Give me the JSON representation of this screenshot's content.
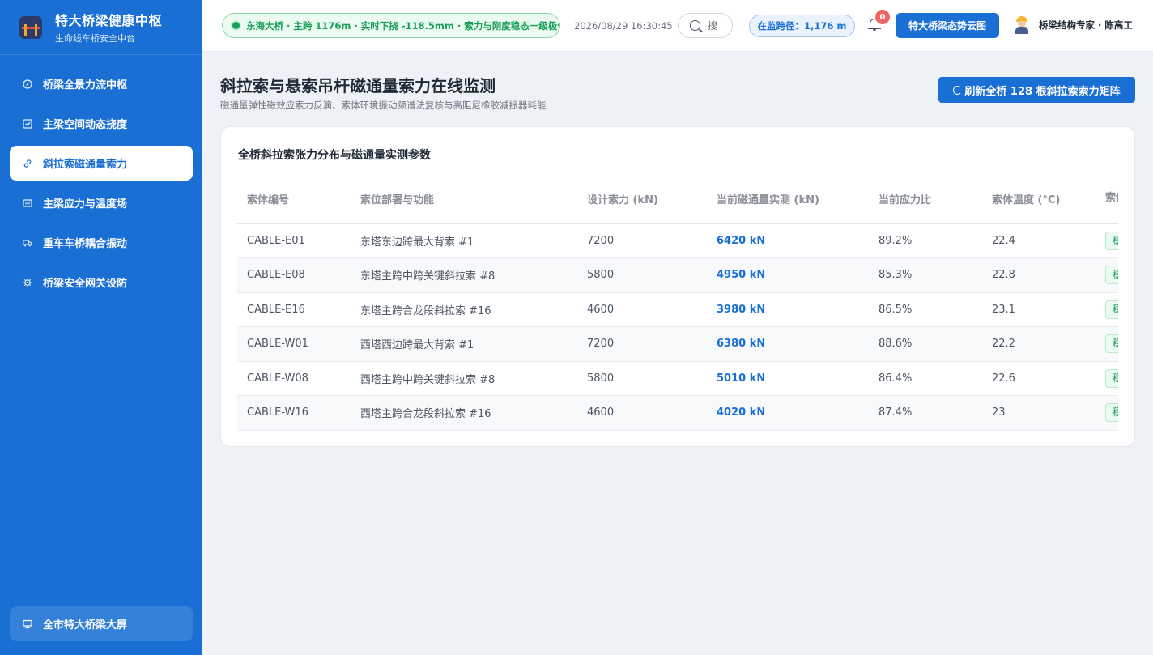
{
  "brand": {
    "title": "特大桥梁健康中枢",
    "subtitle": "生命线车桥安全中台"
  },
  "sidebar": {
    "items": [
      {
        "label": "桥梁全景力流中枢",
        "icon": "compass-icon"
      },
      {
        "label": "主梁空间动态挠度",
        "icon": "line-chart-icon"
      },
      {
        "label": "斜拉索磁通量索力",
        "icon": "link-icon",
        "active": true
      },
      {
        "label": "主梁应力与温度场",
        "icon": "sensor-icon"
      },
      {
        "label": "重车车桥耦合振动",
        "icon": "truck-icon"
      },
      {
        "label": "桥梁安全网关设防",
        "icon": "gear-icon"
      }
    ],
    "footer_label": "全市特大桥梁大屏",
    "footer_icon": "monitor-icon"
  },
  "header": {
    "status_text": "东海大桥 · 主跨 1176m · 实时下挠 -118.5mm · 索力与刚度稳态一级极优",
    "datetime": "2026/08/29 16:30:45",
    "search_placeholder": "搜",
    "span_text": "在监跨径：1,176 m",
    "notification_count": "0",
    "primary_button": "特大桥梁态势云图",
    "user_name": "桥梁结构专家 · 陈高工"
  },
  "page": {
    "title": "斜拉索与悬索吊杆磁通量索力在线监测",
    "subtitle": "磁通量弹性磁效应索力反演、索体环境振动频谱法复核与高阻尼橡胶减振器耗能",
    "refresh_button": "刷新全桥 128 根斜拉索索力矩阵"
  },
  "card": {
    "title": "全桥斜拉索张力分布与磁通量实测参数",
    "columns": [
      "索体编号",
      "索位部署与功能",
      "设计索力 (kN)",
      "当前磁通量实测 (kN)",
      "当前应力比",
      "索体温度 (°C)",
      "索体状态"
    ],
    "rows": [
      {
        "id": "CABLE-E01",
        "position": "东塔东边跨最大背索 #1",
        "design": "7200",
        "flux": "6420 kN",
        "ratio": "89.2%",
        "temp": "22.4",
        "status": "稳定"
      },
      {
        "id": "CABLE-E08",
        "position": "东塔主跨中跨关键斜拉索 #8",
        "design": "5800",
        "flux": "4950 kN",
        "ratio": "85.3%",
        "temp": "22.8",
        "status": "稳定"
      },
      {
        "id": "CABLE-E16",
        "position": "东塔主跨合龙段斜拉索 #16",
        "design": "4600",
        "flux": "3980 kN",
        "ratio": "86.5%",
        "temp": "23.1",
        "status": "稳定"
      },
      {
        "id": "CABLE-W01",
        "position": "西塔西边跨最大背索 #1",
        "design": "7200",
        "flux": "6380 kN",
        "ratio": "88.6%",
        "temp": "22.2",
        "status": "稳定"
      },
      {
        "id": "CABLE-W08",
        "position": "西塔主跨中跨关键斜拉索 #8",
        "design": "5800",
        "flux": "5010 kN",
        "ratio": "86.4%",
        "temp": "22.6",
        "status": "稳定"
      },
      {
        "id": "CABLE-W16",
        "position": "西塔主跨合龙段斜拉索 #16",
        "design": "4600",
        "flux": "4020 kN",
        "ratio": "87.4%",
        "temp": "23",
        "status": "稳定"
      }
    ]
  },
  "colors": {
    "primary": "#1a6fd4",
    "success": "#18a058",
    "danger": "#f06464",
    "background": "#eef2f7"
  }
}
